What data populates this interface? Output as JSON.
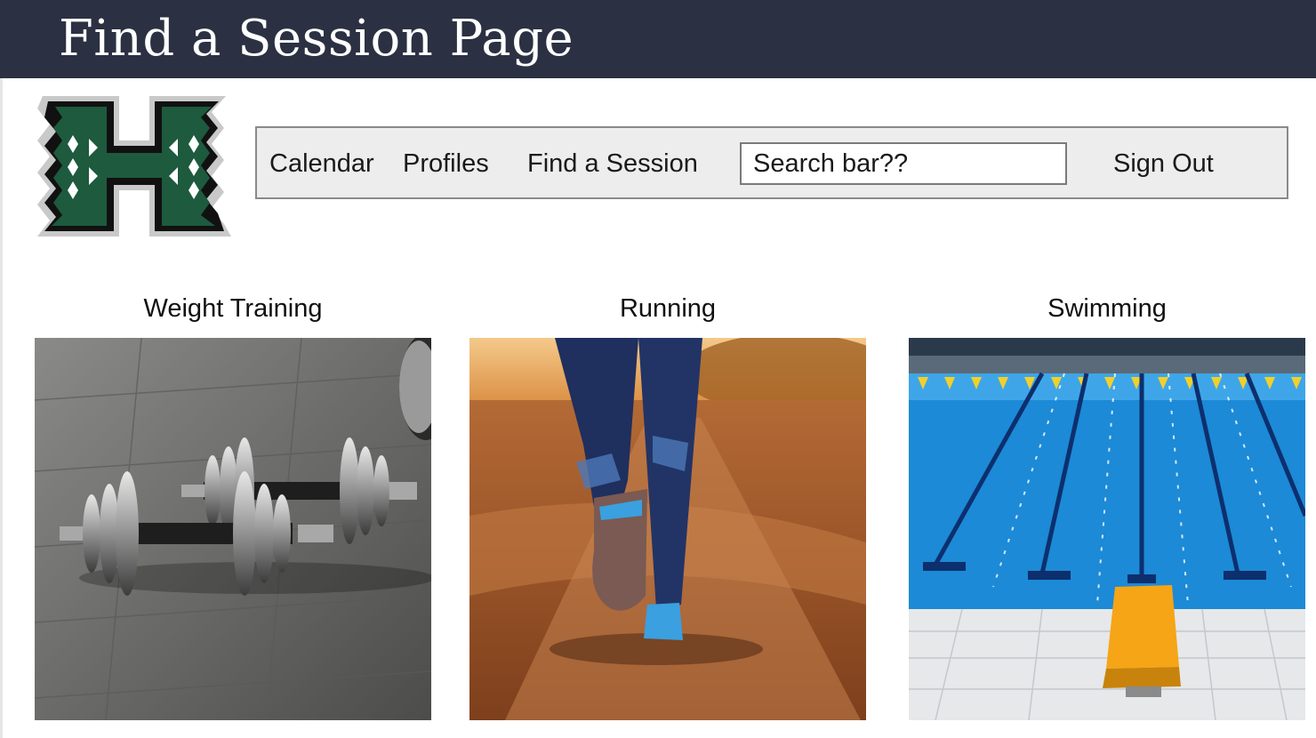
{
  "slide": {
    "title": "Find a Session Page"
  },
  "nav": {
    "calendar": "Calendar",
    "profiles": "Profiles",
    "find_session": "Find a Session",
    "search_placeholder": "Search bar??",
    "sign_out": "Sign Out"
  },
  "sessions": [
    {
      "label": "Weight Training",
      "icon": "dumbbell-icon"
    },
    {
      "label": "Running",
      "icon": "running-icon"
    },
    {
      "label": "Swimming",
      "icon": "swimming-pool-icon"
    }
  ],
  "colors": {
    "title_bar": "#2b3142",
    "logo_green": "#1d5a3e",
    "nav_background": "#ededed"
  }
}
